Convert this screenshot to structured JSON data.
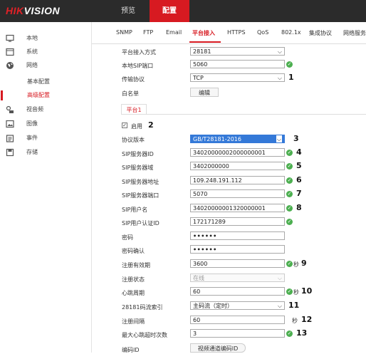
{
  "brand": {
    "part1": "HIK",
    "part2": "VISION"
  },
  "topnav": [
    {
      "label": "预览",
      "active": false
    },
    {
      "label": "配置",
      "active": true
    }
  ],
  "sidebar": {
    "items": [
      {
        "label": "本地",
        "icon": "monitor-icon"
      },
      {
        "label": "系统",
        "icon": "system-icon"
      },
      {
        "label": "网络",
        "icon": "globe-icon"
      },
      {
        "label": "视音频",
        "icon": "audio-video-icon"
      },
      {
        "label": "图像",
        "icon": "image-icon"
      },
      {
        "label": "事件",
        "icon": "event-icon"
      },
      {
        "label": "存储",
        "icon": "storage-icon"
      }
    ],
    "subitems": [
      {
        "label": "基本配置",
        "active": false
      },
      {
        "label": "高级配置",
        "active": true
      }
    ]
  },
  "tabs": [
    "SNMP",
    "FTP",
    "Email",
    "平台接入",
    "HTTPS",
    "QoS",
    "802.1x",
    "集成协议",
    "网络服务"
  ],
  "active_tab": "平台接入",
  "form": {
    "access_mode_label": "平台接入方式",
    "access_mode_value": "28181",
    "local_sip_port_label": "本地SIP端口",
    "local_sip_port_value": "5060",
    "transport_label": "传输协议",
    "transport_value": "TCP",
    "whitelist_label": "白名单",
    "edit_button": "编辑",
    "platform_tab": "平台1",
    "enable_label": "启用",
    "enable_checked": "✓",
    "protocol_version_label": "协议版本",
    "protocol_version_value": "GB/T28181-2016",
    "sip_server_id_label": "SIP服务器ID",
    "sip_server_id_value": "34020000002000000001",
    "sip_server_domain_label": "SIP服务器域",
    "sip_server_domain_value": "3402000000",
    "sip_server_addr_label": "SIP服务器地址",
    "sip_server_addr_value": "109.248.191.112",
    "sip_server_port_label": "SIP服务器端口",
    "sip_server_port_value": "5070",
    "sip_user_label": "SIP用户名",
    "sip_user_value": "34020000001320000001",
    "sip_auth_label": "SIP用户认证ID",
    "sip_auth_value": "172171289",
    "password_label": "密码",
    "password_value": "••••••",
    "password_confirm_label": "密码确认",
    "password_confirm_value": "••••••",
    "reg_expiry_label": "注册有效期",
    "reg_expiry_value": "3600",
    "reg_status_label": "注册状态",
    "reg_status_value": "在线",
    "heartbeat_label": "心跳周期",
    "heartbeat_value": "60",
    "stream_index_label": "28181码流索引",
    "stream_index_value": "主码流（定时）",
    "reg_interval_label": "注册间隔",
    "reg_interval_value": "60",
    "max_heartbeat_label": "最大心跳超时次数",
    "max_heartbeat_value": "3",
    "encode_id_label": "编码ID",
    "encode_id_button": "视频通道编码ID",
    "unit_seconds": "秒"
  },
  "annotations": [
    "1",
    "2",
    "3",
    "4",
    "5",
    "6",
    "7",
    "8",
    "9",
    "10",
    "11",
    "12",
    "13"
  ],
  "colors": {
    "accent": "#d71a21",
    "ok": "#4caf50",
    "topbar": "#2b2b2b",
    "highlight": "#3479d8"
  }
}
